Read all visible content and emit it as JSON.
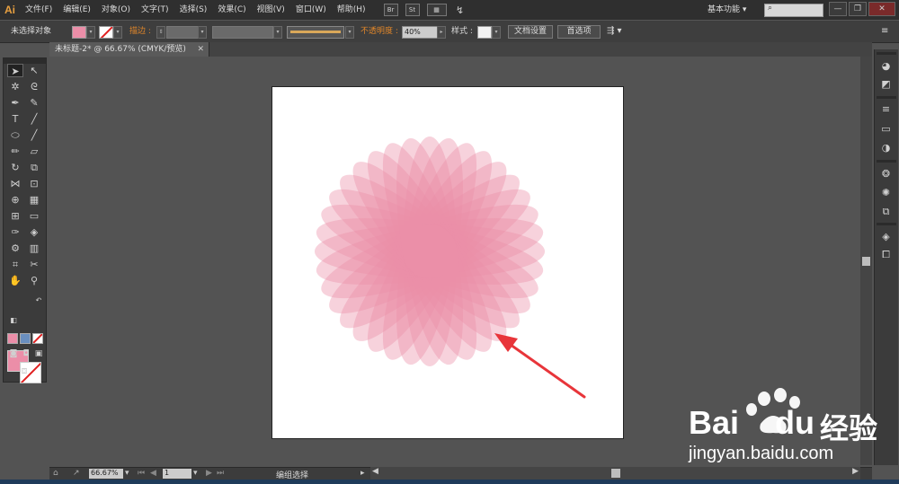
{
  "app": {
    "logo": "Ai"
  },
  "menu": [
    "文件(F)",
    "编辑(E)",
    "对象(O)",
    "文字(T)",
    "选择(S)",
    "效果(C)",
    "视图(V)",
    "窗口(W)",
    "帮助(H)"
  ],
  "menubar_icons": {
    "br": "Br",
    "st": "St"
  },
  "workspace": {
    "label": "基本功能",
    "arrow": "▾"
  },
  "search": {
    "icon": "search-icon",
    "placeholder": ""
  },
  "window_buttons": [
    "—",
    "❐",
    "✕"
  ],
  "control": {
    "selection_status": "未选择对象",
    "stroke_label": "描边 :",
    "opacity_label": "不透明度 :",
    "opacity_value": "40%",
    "style_label": "样式 :",
    "doc_setup": "文档设置",
    "preferences": "首选项",
    "fill_color": "#eb8ea8"
  },
  "document_tab": {
    "title": "未标题-2* @ 66.67% (CMYK/预览)",
    "close": "✕"
  },
  "status": {
    "zoom": "66.67%",
    "page": "1",
    "tool_status": "编组选择"
  },
  "colors": {
    "petal": "#eb8ea8",
    "arrow": "#e8353a",
    "artboard": "#ffffff",
    "workspace_bg": "#535353"
  },
  "watermark": {
    "brand": "Bai",
    "brand2": "du",
    "cn": "经验",
    "url": "jingyan.baidu.com"
  }
}
